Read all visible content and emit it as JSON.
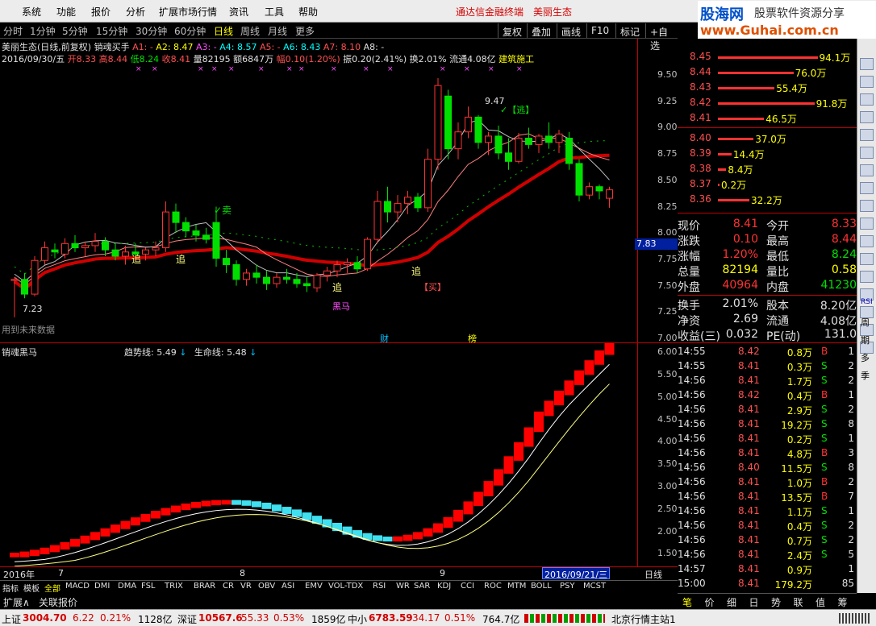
{
  "menu": {
    "items": [
      "系统",
      "功能",
      "报价",
      "分析",
      "扩展市场行情",
      "资讯",
      "工具",
      "帮助"
    ],
    "app_title": "通达信金融终端",
    "stock_name_title": "美丽生态",
    "logo_cn": "股海网",
    "logo_tag": "股票软件资源分享",
    "logo_url": "www.Guhai.com.cn"
  },
  "periods": [
    "分时",
    "1分钟",
    "5分钟",
    "15分钟",
    "30分钟",
    "60分钟",
    "日线",
    "周线",
    "月线",
    "更多"
  ],
  "selected_period": "日线",
  "toolbar_btns": [
    "复权",
    "叠加",
    "画线",
    "F10",
    "标记",
    "+自选"
  ],
  "main_info": {
    "line1": {
      "title": "美丽生态(日线,前复权)",
      "indicator": "销魂买手",
      "a1": "A1: -",
      "a2": "A2: 8.47",
      "a3": "A3: -",
      "a4": "A4: 8.57",
      "a5": "A5: -",
      "a6": "A6: 8.43",
      "a7": "A7: 8.10",
      "a8": "A8: -"
    },
    "line2": {
      "date": "2016/09/30/五",
      "open": "开8.33",
      "high": "高8.44",
      "low": "低8.24",
      "close": "收8.41",
      "vol": "量82195",
      "amt": "额6847万",
      "fu": "幅0.10(1.20%)",
      "zhen": "振0.20(2.41%)",
      "huan": "换2.01%",
      "liutong": "流通4.08亿",
      "industry": "建筑施工"
    }
  },
  "price_axis": [
    "9.50",
    "9.25",
    "9.00",
    "8.75",
    "8.50",
    "8.25",
    "8.00",
    "7.75",
    "7.50",
    "7.25",
    "7.00"
  ],
  "price_marker": "7.83",
  "annotations": {
    "high": "9.47",
    "low": "7.23",
    "escape": "✓【逃】",
    "sell": "✓卖",
    "chase": "追",
    "blackhorse": "黑马",
    "buy": "【买】",
    "future": "用到未来数据",
    "cai": "财",
    "bang": "榜"
  },
  "sub_info": {
    "title": "销魂黑马",
    "trend": "趋势线: 5.49",
    "life": "生命线: 5.48"
  },
  "sub_axis": [
    "6.00",
    "5.50",
    "5.00",
    "4.50",
    "4.00",
    "3.50",
    "3.00",
    "2.50",
    "2.00",
    "1.50"
  ],
  "x_labels": {
    "year": "2016年",
    "m7": "7",
    "m8": "8",
    "m9": "9",
    "date_box": "2016/09/21/三",
    "period": "日线"
  },
  "bottom_tabs": [
    "指标",
    "模板",
    "全部",
    "MACD",
    "DMI",
    "DMA",
    "FSL",
    "TRIX",
    "BRAR",
    "CR",
    "VR",
    "OBV",
    "ASI",
    "EMV",
    "VOL-TDX",
    "RSI",
    "WR",
    "SAR",
    "KDJ",
    "CCI",
    "ROC",
    "MTM",
    "BOLL",
    "PSY",
    "MCST"
  ],
  "expand": [
    "扩展∧",
    "关联报价"
  ],
  "orderbook": {
    "asks": [
      {
        "p": "8.45",
        "v": "94.1万",
        "w": 0.95
      },
      {
        "p": "8.44",
        "v": "76.0万",
        "w": 0.72
      },
      {
        "p": "8.43",
        "v": "55.4万",
        "w": 0.54
      },
      {
        "p": "8.42",
        "v": "91.8万",
        "w": 0.92
      },
      {
        "p": "8.41",
        "v": "46.5万",
        "w": 0.44
      }
    ],
    "bids": [
      {
        "p": "8.40",
        "v": "37.0万",
        "w": 0.34
      },
      {
        "p": "8.39",
        "v": "14.4万",
        "w": 0.13
      },
      {
        "p": "8.38",
        "v": "8.4万",
        "w": 0.08
      },
      {
        "p": "8.37",
        "v": "0.2万",
        "w": 0.01
      },
      {
        "p": "8.36",
        "v": "32.2万",
        "w": 0.3
      }
    ]
  },
  "quote": [
    {
      "l": "现价",
      "v": "8.41",
      "l2": "今开",
      "v2": "8.33",
      "c": "#ff3232",
      "c2": "#ff3232"
    },
    {
      "l": "涨跌",
      "v": "0.10",
      "l2": "最高",
      "v2": "8.44",
      "c": "#ff3232",
      "c2": "#ff3232"
    },
    {
      "l": "涨幅",
      "v": "1.20%",
      "l2": "最低",
      "v2": "8.24",
      "c": "#ff3232",
      "c2": "#00e000"
    },
    {
      "l": "总量",
      "v": "82194",
      "l2": "量比",
      "v2": "0.58",
      "c": "#ffff00",
      "c2": "#ffff00"
    },
    {
      "l": "外盘",
      "v": "40964",
      "l2": "内盘",
      "v2": "41230",
      "c": "#ff3232",
      "c2": "#00e000"
    }
  ],
  "quote2": [
    {
      "l": "换手",
      "v": "2.01%",
      "l2": "股本",
      "v2": "8.20亿"
    },
    {
      "l": "净资",
      "v": "2.69",
      "l2": "流通",
      "v2": "4.08亿"
    },
    {
      "l": "收益(三)",
      "v": "0.032",
      "l2": "PE(动)",
      "v2": "131.0"
    }
  ],
  "ticks": [
    {
      "t": "14:55",
      "p": "8.42",
      "v": "0.8万",
      "d": "B",
      "n": "1"
    },
    {
      "t": "14:55",
      "p": "8.41",
      "v": "0.3万",
      "d": "S",
      "n": "2"
    },
    {
      "t": "14:56",
      "p": "8.41",
      "v": "1.7万",
      "d": "S",
      "n": "2"
    },
    {
      "t": "14:56",
      "p": "8.42",
      "v": "0.4万",
      "d": "B",
      "n": "1"
    },
    {
      "t": "14:56",
      "p": "8.41",
      "v": "2.9万",
      "d": "S",
      "n": "2"
    },
    {
      "t": "14:56",
      "p": "8.41",
      "v": "19.2万",
      "d": "S",
      "n": "8"
    },
    {
      "t": "14:56",
      "p": "8.41",
      "v": "0.2万",
      "d": "S",
      "n": "1"
    },
    {
      "t": "14:56",
      "p": "8.41",
      "v": "4.8万",
      "d": "B",
      "n": "3"
    },
    {
      "t": "14:56",
      "p": "8.40",
      "v": "11.5万",
      "d": "S",
      "n": "8"
    },
    {
      "t": "14:56",
      "p": "8.41",
      "v": "1.0万",
      "d": "B",
      "n": "2"
    },
    {
      "t": "14:56",
      "p": "8.41",
      "v": "13.5万",
      "d": "B",
      "n": "7"
    },
    {
      "t": "14:56",
      "p": "8.41",
      "v": "1.1万",
      "d": "S",
      "n": "1"
    },
    {
      "t": "14:56",
      "p": "8.41",
      "v": "0.4万",
      "d": "S",
      "n": "2"
    },
    {
      "t": "14:56",
      "p": "8.41",
      "v": "0.7万",
      "d": "S",
      "n": "2"
    },
    {
      "t": "14:56",
      "p": "8.41",
      "v": "2.4万",
      "d": "S",
      "n": "5"
    },
    {
      "t": "14:57",
      "p": "8.41",
      "v": "0.9万",
      "d": "",
      "n": "1"
    },
    {
      "t": "15:00",
      "p": "8.41",
      "v": "179.2万",
      "d": "",
      "n": "85"
    }
  ],
  "right_tabs": [
    "笔",
    "价",
    "细",
    "日",
    "势",
    "联",
    "值",
    "筹"
  ],
  "status": {
    "sh_label": "上证",
    "sh": "3004.70",
    "sh_chg": "6.22",
    "sh_pct": "0.21%",
    "sh_amt": "1128亿",
    "sz_label": "深证",
    "sz": "10567.6",
    "sz_chg": "55.33",
    "sz_pct": "0.53%",
    "sz_amt": "1859亿",
    "zx_label": "中小",
    "zx": "6783.59",
    "zx_chg": "34.17",
    "zx_pct": "0.51%",
    "zx_amt": "764.7亿",
    "server": "北京行情主站1"
  },
  "sidebar_text": [
    "RSI",
    "周",
    "期",
    "多",
    "季"
  ],
  "chart_data": {
    "type": "candlestick",
    "main": {
      "ylim": [
        7.0,
        9.6
      ],
      "candles": [
        [
          7.55,
          7.58,
          7.2,
          7.56
        ],
        [
          7.56,
          7.62,
          7.38,
          7.42
        ],
        [
          7.42,
          7.78,
          7.4,
          7.74
        ],
        [
          7.74,
          7.92,
          7.7,
          7.86
        ],
        [
          7.84,
          7.9,
          7.76,
          7.82
        ],
        [
          7.8,
          7.95,
          7.76,
          7.9
        ],
        [
          7.9,
          7.98,
          7.82,
          7.86
        ],
        [
          7.86,
          7.92,
          7.78,
          7.88
        ],
        [
          7.88,
          8.0,
          7.82,
          7.92
        ],
        [
          7.92,
          7.96,
          7.78,
          7.84
        ],
        [
          7.84,
          7.9,
          7.74,
          7.78
        ],
        [
          7.78,
          7.88,
          7.7,
          7.82
        ],
        [
          7.82,
          7.9,
          7.76,
          7.8
        ],
        [
          7.8,
          7.86,
          7.74,
          7.84
        ],
        [
          7.84,
          7.92,
          7.78,
          7.86
        ],
        [
          7.86,
          8.3,
          7.82,
          8.2
        ],
        [
          8.2,
          8.28,
          8.0,
          8.1
        ],
        [
          8.1,
          8.15,
          7.96,
          8.02
        ],
        [
          8.02,
          8.08,
          7.92,
          7.98
        ],
        [
          7.98,
          8.05,
          7.9,
          7.94
        ],
        [
          8.1,
          8.25,
          7.68,
          7.76
        ],
        [
          7.76,
          7.84,
          7.62,
          7.7
        ],
        [
          7.7,
          7.74,
          7.5,
          7.56
        ],
        [
          7.56,
          7.66,
          7.5,
          7.62
        ],
        [
          7.62,
          7.7,
          7.52,
          7.58
        ],
        [
          7.58,
          7.64,
          7.46,
          7.52
        ],
        [
          7.52,
          7.62,
          7.48,
          7.58
        ],
        [
          7.58,
          7.66,
          7.52,
          7.56
        ],
        [
          7.56,
          7.62,
          7.48,
          7.52
        ],
        [
          7.52,
          7.58,
          7.44,
          7.5
        ],
        [
          7.48,
          7.62,
          7.44,
          7.6
        ],
        [
          7.6,
          7.68,
          7.54,
          7.64
        ],
        [
          7.64,
          7.74,
          7.58,
          7.7
        ],
        [
          7.7,
          7.76,
          7.62,
          7.72
        ],
        [
          7.72,
          7.78,
          7.62,
          7.66
        ],
        [
          7.66,
          7.96,
          7.64,
          7.94
        ],
        [
          7.94,
          8.4,
          7.9,
          8.3
        ],
        [
          8.3,
          8.44,
          8.1,
          8.2
        ],
        [
          8.2,
          8.36,
          8.1,
          8.28
        ],
        [
          8.28,
          8.4,
          8.18,
          8.34
        ],
        [
          8.34,
          8.38,
          8.2,
          8.24
        ],
        [
          8.24,
          8.8,
          8.2,
          8.7
        ],
        [
          8.7,
          9.47,
          8.6,
          9.4
        ],
        [
          9.3,
          9.36,
          8.7,
          8.8
        ],
        [
          8.8,
          9.05,
          8.7,
          8.96
        ],
        [
          8.96,
          9.2,
          8.9,
          9.1
        ],
        [
          9.1,
          9.12,
          8.8,
          8.86
        ],
        [
          8.86,
          8.96,
          8.74,
          8.92
        ],
        [
          8.92,
          9.02,
          8.7,
          8.76
        ],
        [
          8.76,
          8.9,
          8.6,
          8.68
        ],
        [
          8.68,
          8.95,
          8.66,
          8.9
        ],
        [
          8.9,
          9.0,
          8.8,
          8.84
        ],
        [
          8.84,
          8.94,
          8.76,
          8.92
        ],
        [
          8.92,
          9.05,
          8.8,
          8.86
        ],
        [
          8.86,
          8.98,
          8.76,
          8.94
        ],
        [
          8.9,
          8.96,
          8.6,
          8.66
        ],
        [
          8.66,
          8.7,
          8.3,
          8.36
        ],
        [
          8.36,
          8.48,
          8.32,
          8.44
        ],
        [
          8.44,
          8.46,
          8.32,
          8.4
        ],
        [
          8.33,
          8.44,
          8.24,
          8.41
        ]
      ]
    },
    "sub": {
      "ylim": [
        1.2,
        6.2
      ],
      "trend_last": 5.49,
      "life_last": 5.48
    }
  }
}
